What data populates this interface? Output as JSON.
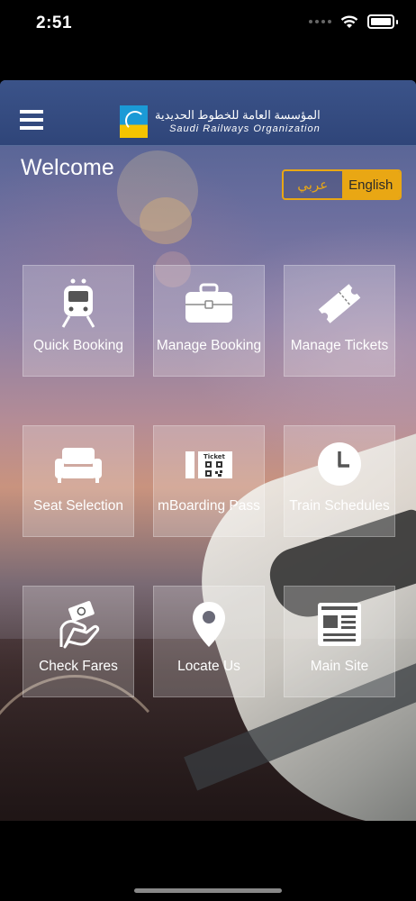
{
  "status": {
    "time": "2:51"
  },
  "header": {
    "logo_arabic": "المؤسسة العامة للخطوط الحديدية",
    "logo_english": "Saudi Railways Organization"
  },
  "welcome": "Welcome",
  "language": {
    "arabic_label": "عربي",
    "english_label": "English",
    "selected": "English",
    "accent_color": "#e9a714"
  },
  "tiles": [
    {
      "label": "Quick Booking",
      "icon": "train-icon"
    },
    {
      "label": "Manage Booking",
      "icon": "briefcase-icon"
    },
    {
      "label": "Manage Tickets",
      "icon": "ticket-icon"
    },
    {
      "label": "Seat Selection",
      "icon": "seat-icon"
    },
    {
      "label": "mBoarding Pass",
      "icon": "boarding-pass-icon",
      "icon_text": "Ticket"
    },
    {
      "label": "Train Schedules",
      "icon": "clock-icon"
    },
    {
      "label": "Check Fares",
      "icon": "money-hand-icon"
    },
    {
      "label": "Locate Us",
      "icon": "location-pin-icon"
    },
    {
      "label": "Main Site",
      "icon": "website-icon"
    }
  ]
}
